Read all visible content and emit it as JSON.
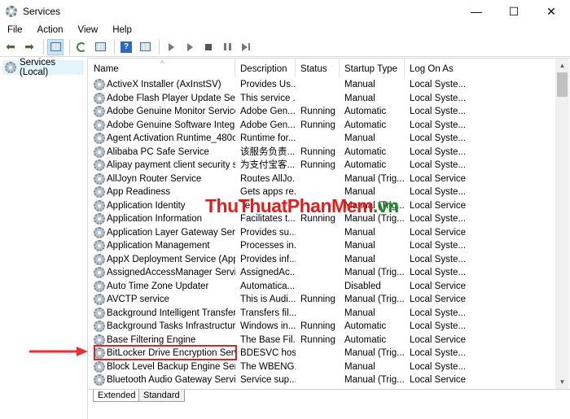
{
  "window": {
    "title": "Services",
    "minimize": "—",
    "maximize": "☐",
    "close": "✕"
  },
  "menu": [
    "File",
    "Action",
    "View",
    "Help"
  ],
  "toolbar_icons": [
    "back-icon",
    "forward-icon",
    "show-hide-tree-icon",
    "refresh-icon",
    "export-list-icon",
    "help-icon",
    "properties-icon",
    "start-service-icon",
    "start-service-alt-icon",
    "stop-service-icon",
    "pause-service-icon",
    "restart-service-icon"
  ],
  "tree": {
    "root_label": "Services (Local)"
  },
  "table": {
    "columns": [
      "Name",
      "Description",
      "Status",
      "Startup Type",
      "Log On As"
    ],
    "rows": [
      {
        "name": "ActiveX Installer (AxInstSV)",
        "desc": "Provides Us...",
        "status": "",
        "start": "Manual",
        "logon": "Local Syste..."
      },
      {
        "name": "Adobe Flash Player Update Service",
        "desc": "This service ...",
        "status": "",
        "start": "Manual",
        "logon": "Local Syste..."
      },
      {
        "name": "Adobe Genuine Monitor Service",
        "desc": "Adobe Gen...",
        "status": "Running",
        "start": "Automatic",
        "logon": "Local Syste..."
      },
      {
        "name": "Adobe Genuine Software Integrit...",
        "desc": "Adobe Gen...",
        "status": "Running",
        "start": "Automatic",
        "logon": "Local Syste..."
      },
      {
        "name": "Agent Activation Runtime_480c9",
        "desc": "Runtime for...",
        "status": "",
        "start": "Manual",
        "logon": "Local Syste..."
      },
      {
        "name": "Alibaba PC Safe Service",
        "desc": "该服务负责...",
        "status": "Running",
        "start": "Automatic",
        "logon": "Local Syste..."
      },
      {
        "name": "Alipay payment client security s...",
        "desc": "为支付宝客...",
        "status": "Running",
        "start": "Automatic",
        "logon": "Local Syste..."
      },
      {
        "name": "AllJoyn Router Service",
        "desc": "Routes AllJo...",
        "status": "",
        "start": "Manual (Trig...",
        "logon": "Local Service"
      },
      {
        "name": "App Readiness",
        "desc": "Gets apps re...",
        "status": "",
        "start": "Manual",
        "logon": "Local Syste..."
      },
      {
        "name": "Application Identity",
        "desc": "Te",
        "status": "",
        "start": "Manual (Trig...",
        "logon": "Local Service"
      },
      {
        "name": "Application Information",
        "desc": "Facilitates t...",
        "status": "Running",
        "start": "Manual (Trig...",
        "logon": "Local Syste..."
      },
      {
        "name": "Application Layer Gateway Service",
        "desc": "Provides su...",
        "status": "",
        "start": "Manual",
        "logon": "Local Service"
      },
      {
        "name": "Application Management",
        "desc": "Processes in...",
        "status": "",
        "start": "Manual",
        "logon": "Local Syste..."
      },
      {
        "name": "AppX Deployment Service (App...",
        "desc": "Provides inf...",
        "status": "",
        "start": "Manual",
        "logon": "Local Syste..."
      },
      {
        "name": "AssignedAccessManager Service",
        "desc": "AssignedAc...",
        "status": "",
        "start": "Manual (Trig...",
        "logon": "Local Syste..."
      },
      {
        "name": "Auto Time Zone Updater",
        "desc": "Automatica...",
        "status": "",
        "start": "Disabled",
        "logon": "Local Service"
      },
      {
        "name": "AVCTP service",
        "desc": "This is Audi...",
        "status": "Running",
        "start": "Manual (Trig...",
        "logon": "Local Service"
      },
      {
        "name": "Background Intelligent Transfer ...",
        "desc": "Transfers fil...",
        "status": "",
        "start": "Manual",
        "logon": "Local Syste..."
      },
      {
        "name": "Background Tasks Infrastructure ...",
        "desc": "Windows in...",
        "status": "Running",
        "start": "Automatic",
        "logon": "Local Syste..."
      },
      {
        "name": "Base Filtering Engine",
        "desc": "The Base Fil...",
        "status": "Running",
        "start": "Automatic",
        "logon": "Local Service"
      },
      {
        "name": "BitLocker Drive Encryption Service",
        "desc": "BDESVC hos...",
        "status": "",
        "start": "Manual (Trig...",
        "logon": "Local Syste..."
      },
      {
        "name": "Block Level Backup Engine Service",
        "desc": "The WBENG...",
        "status": "",
        "start": "Manual",
        "logon": "Local Syste..."
      },
      {
        "name": "Bluetooth Audio Gateway Service",
        "desc": "Service sup...",
        "status": "",
        "start": "Manual (Trig...",
        "logon": "Local Service"
      }
    ]
  },
  "tabs": [
    "Extended",
    "Standard"
  ],
  "watermark": {
    "part1": "Thu",
    "part2": "Thuat",
    "part3": "PhanMem",
    "part4": ".vn"
  },
  "colors": {
    "highlight_box": "#e02020",
    "arrow": "#e63232",
    "selection": "#e5f3fb"
  }
}
